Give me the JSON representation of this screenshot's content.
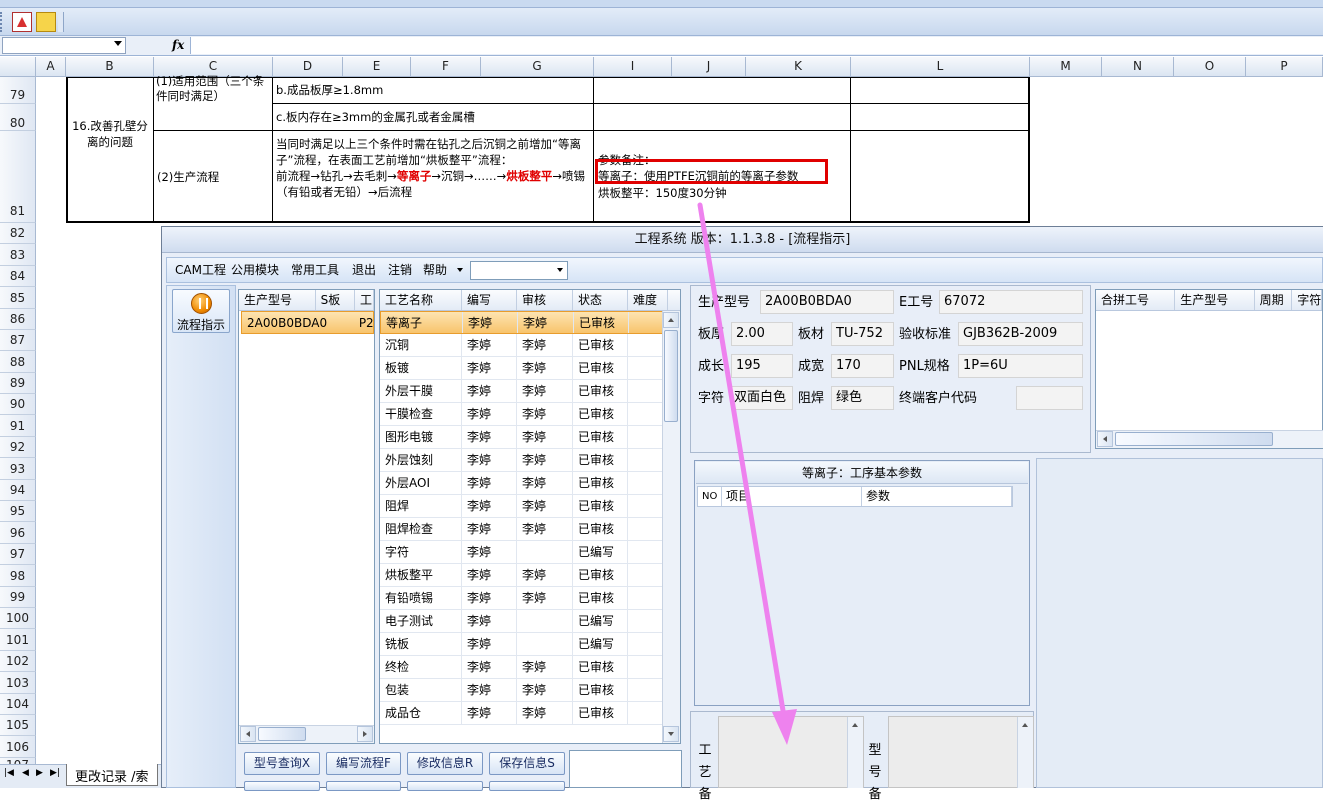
{
  "excel": {
    "column_headers": [
      "A",
      "B",
      "C",
      "D",
      "E",
      "F",
      "G",
      "I",
      "J",
      "K",
      "L",
      "M",
      "N",
      "O",
      "P"
    ],
    "row_numbers": [
      "79",
      "80",
      "81",
      "82",
      "83",
      "84",
      "85",
      "86",
      "87",
      "88",
      "89",
      "90",
      "91",
      "92",
      "93",
      "94",
      "95",
      "96",
      "97",
      "98",
      "99",
      "100",
      "101",
      "102",
      "103",
      "104",
      "105",
      "106",
      "107"
    ],
    "cells": {
      "b_issue": "16.改善孔壁分离的问题",
      "c_scope": "(1)适用范围（三个条件同时满足）",
      "c_process": "(2)生产流程",
      "d_thickness": "b.成品板厚≥1.8mm",
      "d_hole": "c.板内存在≥3mm的金属孔或者金属槽",
      "d_flow_intro": "当同时满足以上三个条件时需在钻孔之后沉铜之前增加“等离子”流程，在表面工艺前增加“烘板整平”流程：",
      "d_flow_a": "前流程→钻孔→去毛刺→",
      "d_flow_red1": "等离子",
      "d_flow_b": "→沉铜→……→",
      "d_flow_red2": "烘板整平",
      "d_flow_c": "→喷锡（有铅或者无铅）→后流程",
      "i_param_title": "参数备注：",
      "i_param_plasma": "等离子：使用PTFE沉铜前的等离子参数",
      "i_param_bake": "烘板整平：150度30分钟"
    },
    "sheet_tab": "更改记录",
    "sheet_tab_more": "索"
  },
  "app": {
    "title": "工程系统   版本：1.1.3.8 - [流程指示]",
    "menu": [
      "CAM工程",
      "公用模块",
      "常用工具",
      "退出",
      "注销",
      "帮助"
    ],
    "nav_button": "流程指示",
    "models": {
      "headers": [
        "生产型号",
        "S板",
        "工"
      ],
      "rows": [
        [
          "2A00B0BDA0",
          "P2"
        ]
      ]
    },
    "processes": {
      "headers": [
        "工艺名称",
        "编写",
        "审核",
        "状态",
        "难度"
      ],
      "rows": [
        [
          "等离子",
          "李婷",
          "李婷",
          "已审核"
        ],
        [
          "沉铜",
          "李婷",
          "李婷",
          "已审核"
        ],
        [
          "板镀",
          "李婷",
          "李婷",
          "已审核"
        ],
        [
          "外层干膜",
          "李婷",
          "李婷",
          "已审核"
        ],
        [
          "干膜检查",
          "李婷",
          "李婷",
          "已审核"
        ],
        [
          "图形电镀",
          "李婷",
          "李婷",
          "已审核"
        ],
        [
          "外层蚀刻",
          "李婷",
          "李婷",
          "已审核"
        ],
        [
          "外层AOI",
          "李婷",
          "李婷",
          "已审核"
        ],
        [
          "阻焊",
          "李婷",
          "李婷",
          "已审核"
        ],
        [
          "阻焊检查",
          "李婷",
          "李婷",
          "已审核"
        ],
        [
          "字符",
          "李婷",
          "",
          "已编写"
        ],
        [
          "烘板整平",
          "李婷",
          "李婷",
          "已审核"
        ],
        [
          "有铅喷锡",
          "李婷",
          "李婷",
          "已审核"
        ],
        [
          "电子测试",
          "李婷",
          "",
          "已编写"
        ],
        [
          "铣板",
          "李婷",
          "",
          "已编写"
        ],
        [
          "终检",
          "李婷",
          "李婷",
          "已审核"
        ],
        [
          "包装",
          "李婷",
          "李婷",
          "已审核"
        ],
        [
          "成品仓",
          "李婷",
          "李婷",
          "已审核"
        ]
      ]
    },
    "info": {
      "model_label": "生产型号",
      "model": "2A00B0BDA0",
      "engineer_label": "E工号",
      "engineer": "67072",
      "thickness_label": "板厚",
      "thickness": "2.00",
      "material_label": "板材",
      "material": "TU-752",
      "standard_label": "验收标准",
      "standard": "GJB362B-2009",
      "length_label": "成长",
      "length": "195",
      "width_label": "成宽",
      "width": "170",
      "pnl_label": "PNL规格",
      "pnl": "1P=6U",
      "char_label": "字符",
      "char": "双面白色",
      "mask_label": "阻焊",
      "mask": "绿色",
      "customer_label": "终端客户代码",
      "customer": ""
    },
    "merge": {
      "headers": [
        "合拼工号",
        "生产型号",
        "周期",
        "字符"
      ]
    },
    "params": {
      "title": "等离子：工序基本参数",
      "headers": [
        "NO",
        "项目",
        "参数"
      ]
    },
    "bottom": {
      "process_label": "工艺备",
      "model_label": "型号备"
    },
    "buttons": {
      "row1": [
        "型号查询X",
        "编写流程F",
        "修改信息R",
        "保存信息S"
      ]
    }
  },
  "colors": {
    "highlight_box": "#e00000",
    "annotation_arrow": "#ee82ee",
    "selected_row": "#f8c46c"
  }
}
